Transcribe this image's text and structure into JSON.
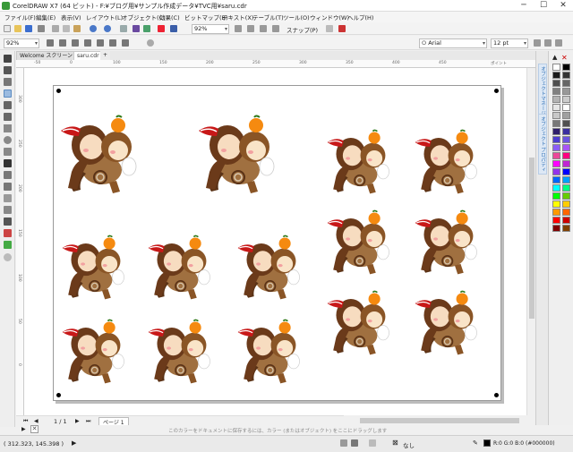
{
  "titlebar": {
    "title": "CorelDRAW X7 (64 ビット) - F:¥ブログ用¥サンプル作成データ¥TVC用¥saru.cdr",
    "minimize": "─",
    "maximize": "☐",
    "close": "✕"
  },
  "menu": {
    "items": [
      "ファイル(F)",
      "編集(E)",
      "表示(V)",
      "レイアウト(L)",
      "オブジェクト(C)",
      "効果(C)",
      "ビットマップ(B)",
      "テキスト(X)",
      "テーブル(T)",
      "ツール(O)",
      "ウィンドウ(W)",
      "ヘルプ(H)"
    ]
  },
  "toolbar1": {
    "zoom_value": "92%",
    "snap_label": "スナップ(P)"
  },
  "toolbar2": {
    "zoom_value": "92%",
    "font_name": "Arial",
    "font_size": "12 pt"
  },
  "tabs": {
    "welcome": "Welcome スクリーン",
    "document": "saru.cdr",
    "add": "+"
  },
  "ruler": {
    "units_label": "ポイント"
  },
  "pagenav": {
    "page_count": "1 / 1",
    "page_tab": "ページ 1"
  },
  "docker": {
    "tab1": "オブジェクトマネージャ",
    "tab2": "オブジェクト プロパティ"
  },
  "palette": {
    "colors": [
      "#ffffff",
      "#000000",
      "#1a1a1a",
      "#333333",
      "#4d4d4d",
      "#666666",
      "#808080",
      "#999999",
      "#b3b3b3",
      "#cccccc",
      "#e6e6e6",
      "#ffffff",
      "#c8c8c8",
      "#a0a0a0",
      "#787878",
      "#505050",
      "#2e1f6b",
      "#3a2fa0",
      "#4b3ccf",
      "#6a55e0",
      "#8b5cf6",
      "#a855f7",
      "#ec4899",
      "#ff0080",
      "#ff00ff",
      "#c026d3",
      "#9333ea",
      "#0000ff",
      "#0066ff",
      "#00a0ff",
      "#00ffff",
      "#00ff80",
      "#00ff00",
      "#66cc00",
      "#ffff00",
      "#ffcc00",
      "#ff9900",
      "#ff6600",
      "#ff0000",
      "#cc0000",
      "#800000",
      "#804000"
    ]
  },
  "hintbar": {
    "hint": "このカラーをドキュメントに保存するには、カラー (またはオブジェクト) をここにドラッグします"
  },
  "status": {
    "coordinates": "( 312.323, 145.398 )",
    "fill_label": "なし",
    "color_readout": "R:0 G:0 B:0 (#000000)"
  }
}
